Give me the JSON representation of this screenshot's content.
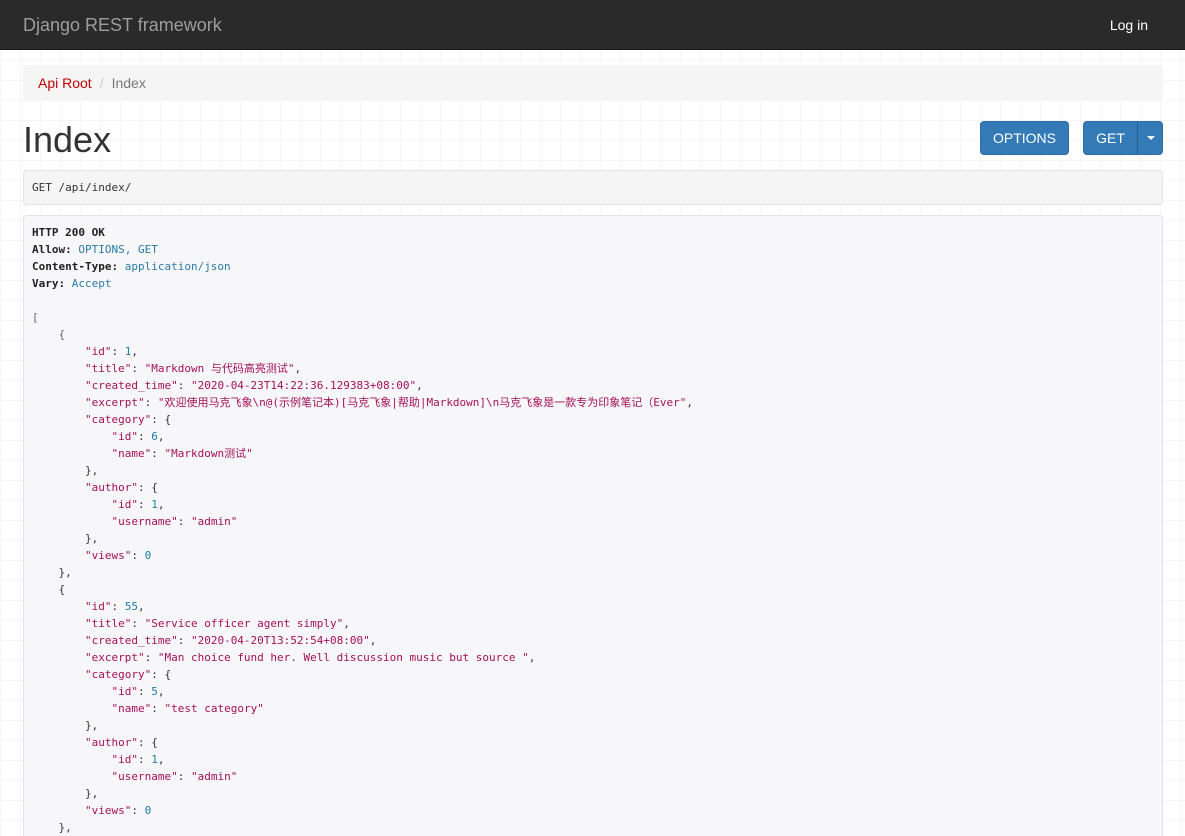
{
  "navbar": {
    "brand": "Django REST framework",
    "login_label": "Log in"
  },
  "breadcrumb": {
    "items": [
      {
        "label": "Api Root"
      },
      {
        "label": "Index"
      }
    ],
    "separator": "/"
  },
  "page": {
    "title": "Index"
  },
  "buttons": {
    "options_label": "OPTIONS",
    "get_label": "GET"
  },
  "request": {
    "text": "GET /api/index/"
  },
  "response": {
    "status_line": "HTTP 200 OK",
    "headers": [
      {
        "name": "Allow:",
        "value": "OPTIONS, GET"
      },
      {
        "name": "Content-Type:",
        "value": "application/json"
      },
      {
        "name": "Vary:",
        "value": "Accept"
      }
    ],
    "items": [
      {
        "id": "1",
        "title": "\"Markdown 与代码高亮测试\"",
        "created_time": "\"2020-04-23T14:22:36.129383+08:00\"",
        "excerpt": "\"欢迎使用马克飞象\\n@(示例笔记本)[马克飞象|帮助|Markdown]\\n马克飞象是一款专为印象笔记（Ever\"",
        "category_id": "6",
        "category_name": "\"Markdown测试\"",
        "author_id": "1",
        "author_username": "\"admin\"",
        "views": "0"
      },
      {
        "id": "55",
        "title": "\"Service officer agent simply\"",
        "created_time": "\"2020-04-20T13:52:54+08:00\"",
        "excerpt": "\"Man choice fund her. Well discussion music but source \"",
        "category_id": "5",
        "category_name": "\"test category\"",
        "author_id": "1",
        "author_username": "\"admin\"",
        "views": "0"
      }
    ]
  },
  "colors": {
    "navbar_bg": "#2a2a2a",
    "link_red": "#c20000",
    "button_blue": "#337ab7",
    "json_key": "#a4105a",
    "json_number": "#1d7ca8"
  }
}
